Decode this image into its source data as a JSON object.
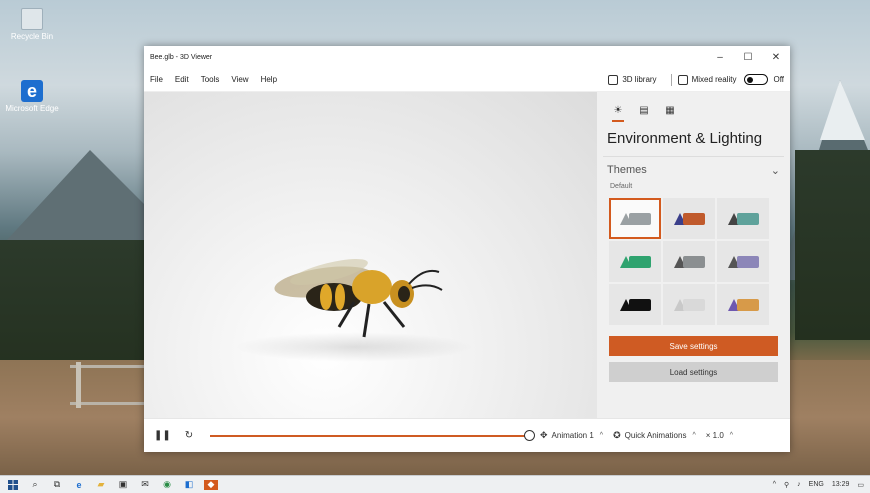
{
  "desktop": {
    "icons": [
      {
        "label": "Recycle Bin"
      },
      {
        "label": "Microsoft Edge"
      }
    ]
  },
  "window": {
    "title": "Bee.glb - 3D Viewer",
    "controls": {
      "minimize": "–",
      "maximize": "☐",
      "close": "✕"
    }
  },
  "menu": {
    "items": [
      "File",
      "Edit",
      "Tools",
      "View",
      "Help"
    ],
    "library_label": "3D library",
    "mixed_reality_label": "Mixed reality",
    "toggle_state": "Off"
  },
  "panel": {
    "title": "Environment & Lighting",
    "themes_label": "Themes",
    "default_label": "Default",
    "themes": [
      {
        "colors": [
          "#9aa0a3"
        ],
        "cone": "#9aa0a3"
      },
      {
        "colors": [
          "#c05a2c"
        ],
        "cone": "#3b3f8a"
      },
      {
        "colors": [
          "#5fa29b"
        ],
        "cone": "#444"
      },
      {
        "colors": [
          "#2fa36f"
        ],
        "cone": "#2fa36f"
      },
      {
        "colors": [
          "#8b8f91"
        ],
        "cone": "#555"
      },
      {
        "colors": [
          "#8c86b8"
        ],
        "cone": "#555"
      },
      {
        "colors": [
          "#111111"
        ],
        "cone": "#111"
      },
      {
        "colors": [
          "#d9d9d9"
        ],
        "cone": "#c9c9c9"
      },
      {
        "colors": [
          "#d79a49"
        ],
        "cone": "#6e58b0"
      }
    ],
    "save_label": "Save settings",
    "load_label": "Load settings"
  },
  "playback": {
    "progress": 1.0,
    "animation_label": "Animation 1",
    "quick_label": "Quick Animations",
    "speed_label": "× 1.0"
  },
  "taskbar": {
    "language": "ENG",
    "time": "13:29"
  }
}
